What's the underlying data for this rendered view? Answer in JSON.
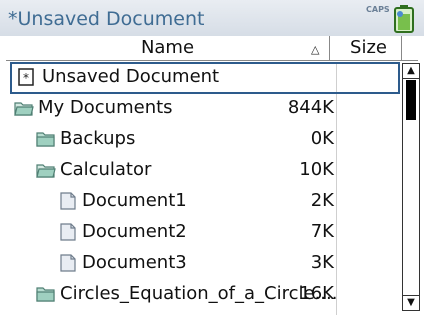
{
  "titlebar": {
    "title": "*Unsaved Document",
    "caps": "CAPS"
  },
  "header": {
    "name_label": "Name",
    "size_label": "Size"
  },
  "rows": [
    {
      "label": "Unsaved Document",
      "size": "",
      "icon": "unsaved-doc-icon"
    },
    {
      "label": "My Documents",
      "size": "844K",
      "icon": "open-folder-icon"
    },
    {
      "label": "Backups",
      "size": "0K",
      "icon": "folder-icon"
    },
    {
      "label": "Calculator",
      "size": "10K",
      "icon": "open-folder-icon"
    },
    {
      "label": "Document1",
      "size": "2K",
      "icon": "document-icon"
    },
    {
      "label": "Document2",
      "size": "7K",
      "icon": "document-icon"
    },
    {
      "label": "Document3",
      "size": "3K",
      "icon": "document-icon"
    },
    {
      "label": "Circles_Equation_of_a_Circle....",
      "size": "16K",
      "icon": "folder-icon"
    }
  ],
  "colors": {
    "title_text": "#3f6c93",
    "selection_border": "#2d5b8c"
  }
}
